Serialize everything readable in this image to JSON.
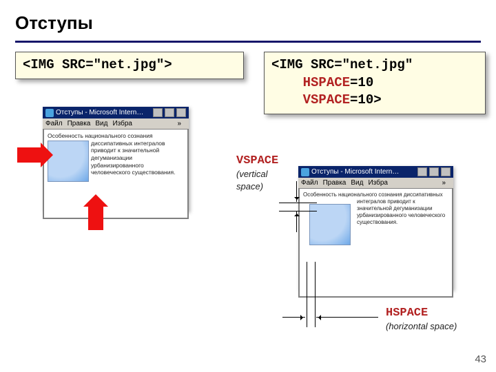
{
  "title": "Отступы",
  "page_number": "43",
  "code_left": "<IMG SRC=\"net.jpg\">",
  "code_right_plain": "<IMG SRC=\"net.jpg\"\n    ",
  "code_right_kw1": "HSPACE",
  "code_right_mid1": "=10\n    ",
  "code_right_kw2": "VSPACE",
  "code_right_mid2": "=10>",
  "browser": {
    "title": "Отступы - Microsoft Intern…",
    "menu": {
      "file": "Файл",
      "edit": "Правка",
      "view": "Вид",
      "fav": "Избра",
      "chev": "»"
    },
    "para_full": "Особенность национального сознания диссипативных интегралов приводит к значительной дегуманизации урбанизированного человеческого существования.",
    "para_head": "Особенность национального сознания диссипативных",
    "para_tail": "интегралов приводит к значительной дегуманизации урбанизированного человеческого существования."
  },
  "labels": {
    "vspace": "VSPACE",
    "vspace_sub": "(vertical space)",
    "hspace": "HSPACE",
    "hspace_sub": "(horizontal space)"
  }
}
